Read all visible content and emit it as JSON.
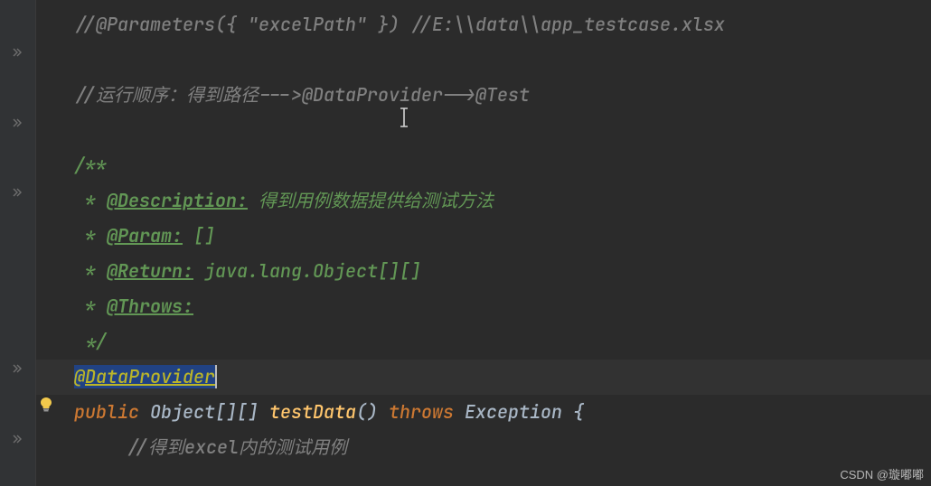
{
  "code": {
    "line1": "//@Parameters({ \"excelPath\" }) //E:\\\\data\\\\app_testcase.xlsx",
    "line2": "",
    "line3": "//运行顺序：得到路径--->@DataProvider-->@Test",
    "line4": "",
    "line5_open": "/**",
    "line6_star": " * ",
    "line6_tag": "@Description:",
    "line6_desc": " 得到用例数据提供给测试方法",
    "line7_star": " * ",
    "line7_tag": "@Param:",
    "line7_desc": " []",
    "line8_star": " * ",
    "line8_tag": "@Return:",
    "line8_desc": " java.lang.Object[][]",
    "line9_star": " * ",
    "line9_tag": "@Throws:",
    "line10_close": " */",
    "line11_at": "@",
    "line11_annotation": "DataProvider",
    "line12_public": "public",
    "line12_type": " Object[][] ",
    "line12_method": "testData",
    "line12_parens": "() ",
    "line12_throws": "throws",
    "line12_exc": " Exception ",
    "line12_brace": "{",
    "line13": "//得到excel内的测试用例"
  },
  "watermark": "CSDN @璇嘟嘟"
}
